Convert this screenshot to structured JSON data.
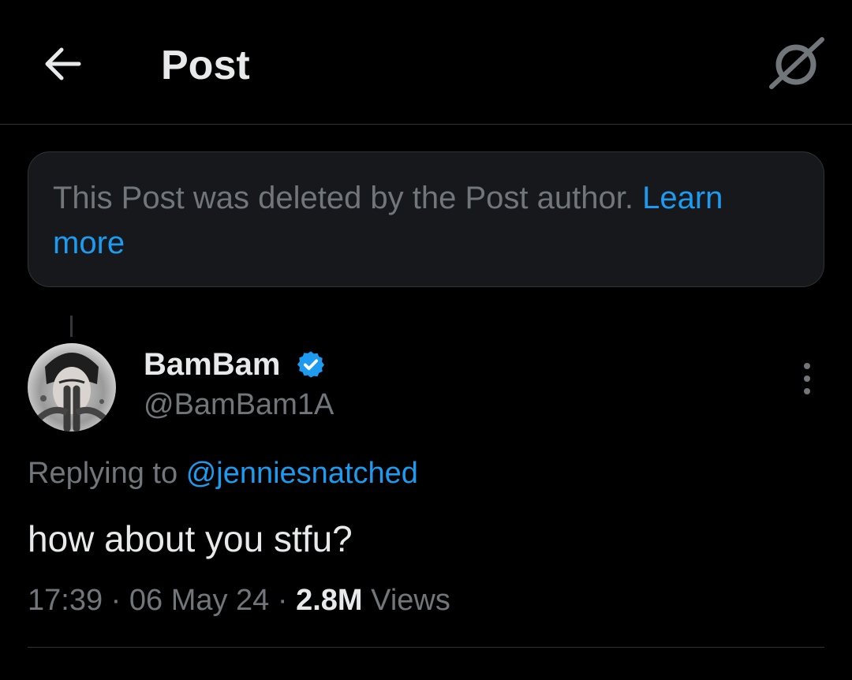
{
  "header": {
    "back_icon": "arrow-left-icon",
    "title": "Post",
    "grok_icon": "grok-icon"
  },
  "notice": {
    "text": "This Post was deleted by the Post author.",
    "link_text": "Learn more"
  },
  "tweet": {
    "display_name": "BamBam",
    "verified_icon": "verified-badge-icon",
    "handle": "@BamBam1A",
    "more_icon": "more-vertical-icon",
    "replying_prefix": "Replying to",
    "replying_to": "@jenniesnatched",
    "text": "how about you stfu?",
    "time": "17:39",
    "date": "06 May 24",
    "views_count": "2.8M",
    "views_label": "Views",
    "separator": "·"
  },
  "colors": {
    "background": "#000000",
    "primary_text": "#e7e9ea",
    "secondary_text": "#71767b",
    "accent": "#1d9bf0",
    "notice_bg": "#16181c",
    "border": "#2f3336"
  }
}
